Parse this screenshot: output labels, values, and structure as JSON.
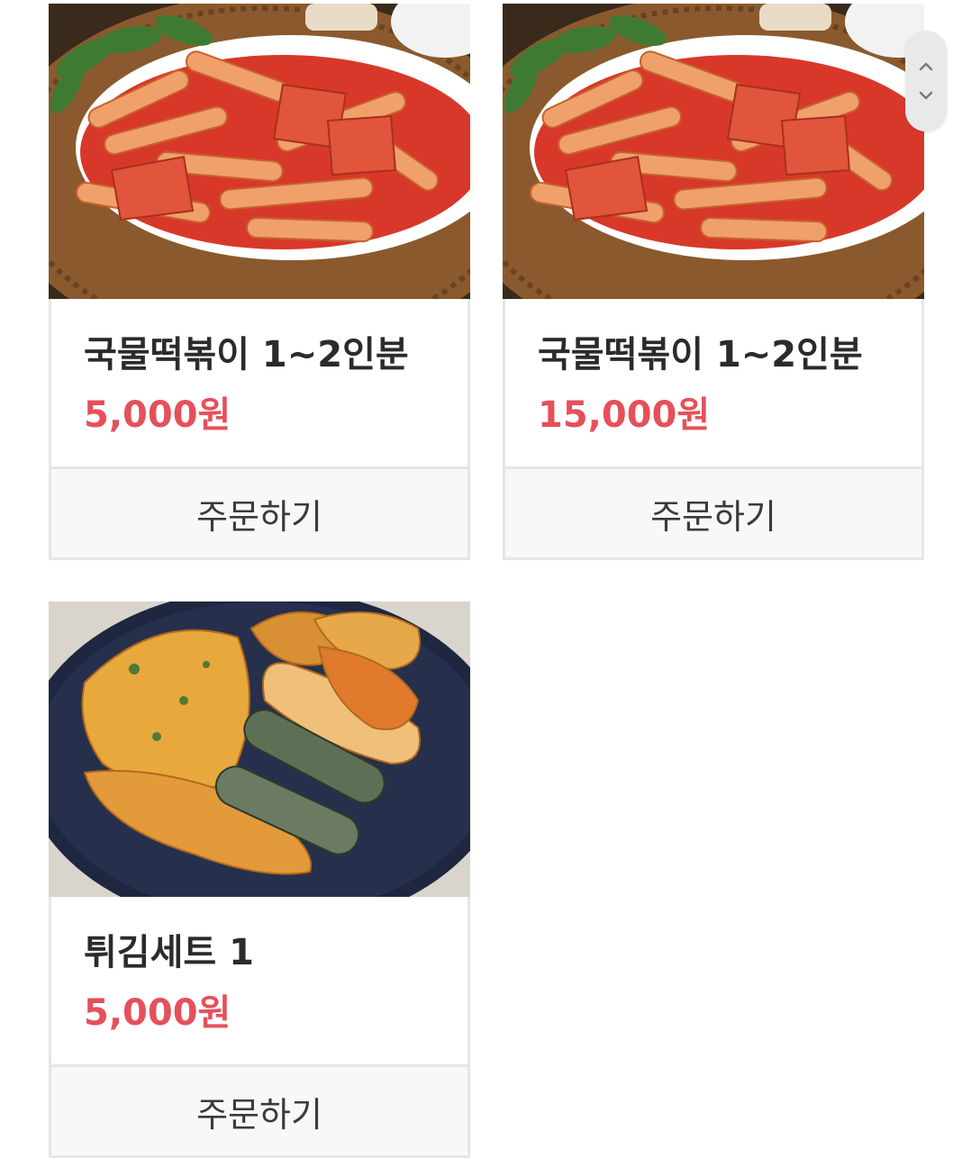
{
  "products": [
    {
      "title": "국물떡볶이 1~2인분",
      "price": "5,000원",
      "button": "주문하기",
      "image": "tteokbokki-photo"
    },
    {
      "title": "국물떡볶이 1~2인분",
      "price": "15,000원",
      "button": "주문하기",
      "image": "tteokbokki-photo"
    },
    {
      "title": "튀김세트 1",
      "price": "5,000원",
      "button": "주문하기",
      "image": "fried-set-photo"
    }
  ],
  "scroll": {
    "up_icon": "chevron-up-icon",
    "down_icon": "chevron-down-icon"
  },
  "colors": {
    "price": "#e6505a",
    "border": "#e6e6e6",
    "button_bg": "#f7f8fa"
  }
}
